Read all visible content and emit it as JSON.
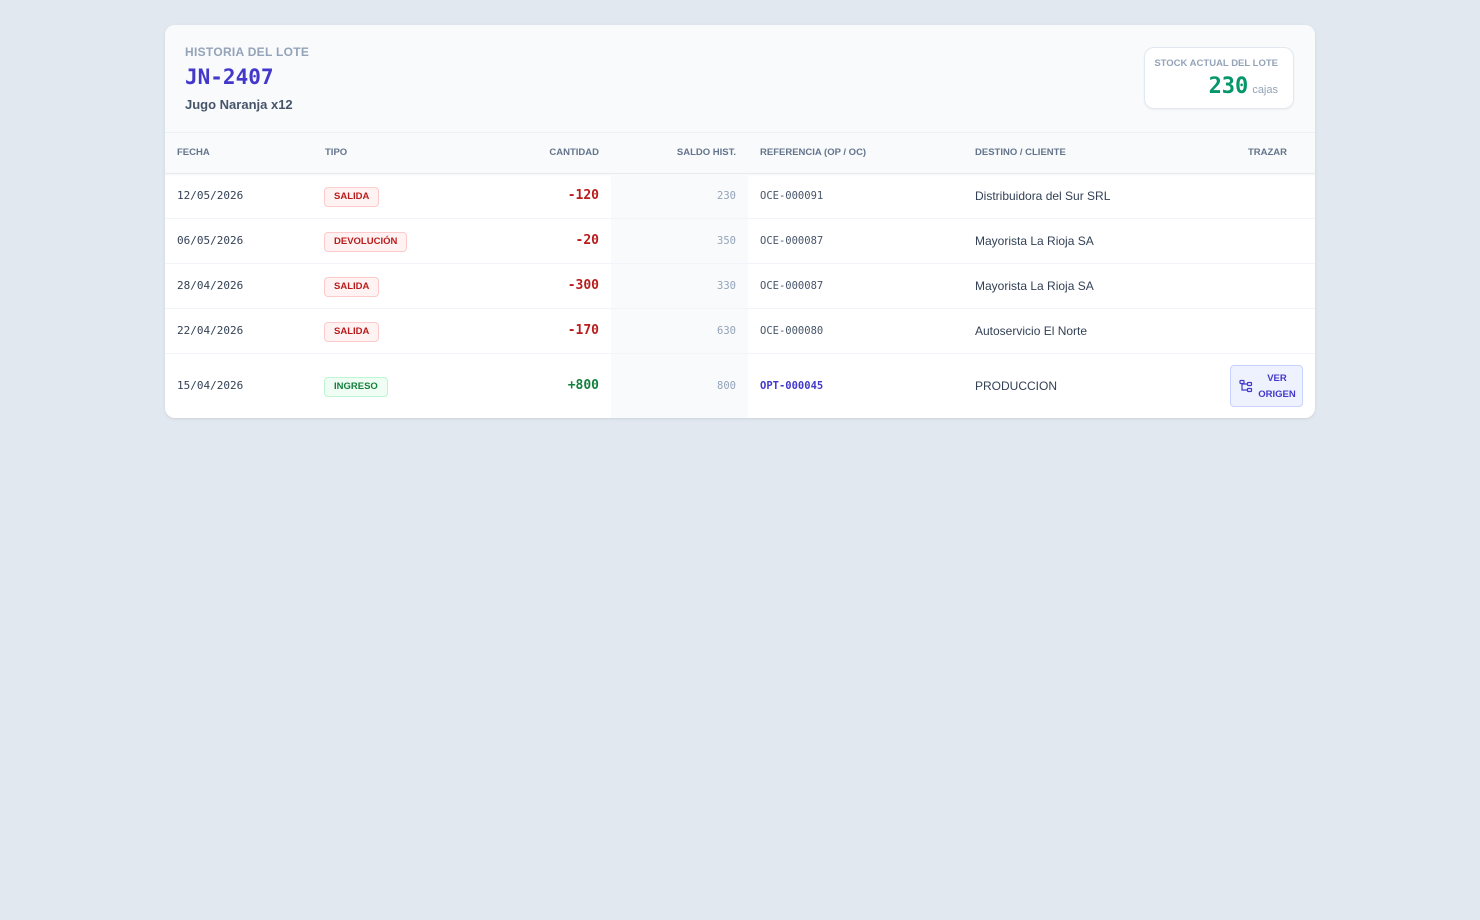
{
  "header": {
    "kicker": "HISTORIA DEL LOTE",
    "lot_code": "JN-2407",
    "product": "Jugo Naranja x12"
  },
  "stock": {
    "label": "STOCK ACTUAL DEL LOTE",
    "value": "230",
    "unit": "cajas"
  },
  "table": {
    "columns": {
      "fecha": "FECHA",
      "tipo": "TIPO",
      "cantidad": "CANTIDAD",
      "saldo": "SALDO HIST.",
      "referencia": "REFERENCIA (OP / OC)",
      "destino": "DESTINO / CLIENTE",
      "trazar": "TRAZAR"
    },
    "rows": [
      {
        "fecha": "12/05/2026",
        "tipo": "SALIDA",
        "cantidad": "-120",
        "saldo": "230",
        "referencia": "OCE-000091",
        "destino": "Distribuidora del Sur SRL"
      },
      {
        "fecha": "06/05/2026",
        "tipo": "DEVOLUCIÓN",
        "cantidad": "-20",
        "saldo": "350",
        "referencia": "OCE-000087",
        "destino": "Mayorista La Rioja SA"
      },
      {
        "fecha": "28/04/2026",
        "tipo": "SALIDA",
        "cantidad": "-300",
        "saldo": "330",
        "referencia": "OCE-000087",
        "destino": "Mayorista La Rioja SA"
      },
      {
        "fecha": "22/04/2026",
        "tipo": "SALIDA",
        "cantidad": "-170",
        "saldo": "630",
        "referencia": "OCE-000080",
        "destino": "Autoservicio El Norte"
      },
      {
        "fecha": "15/04/2026",
        "tipo": "INGRESO",
        "cantidad": "+800",
        "saldo": "800",
        "referencia": "OPT-000045",
        "destino": "PRODUCCION",
        "trazar": "VER ORIGEN"
      }
    ]
  },
  "colors": {
    "accent": "#4338ca",
    "stock": "#059669",
    "negative": "#b91c1c",
    "positive": "#15803d",
    "background": "#e2e8f0"
  },
  "icons": {
    "trace": "flow-tree-icon"
  }
}
